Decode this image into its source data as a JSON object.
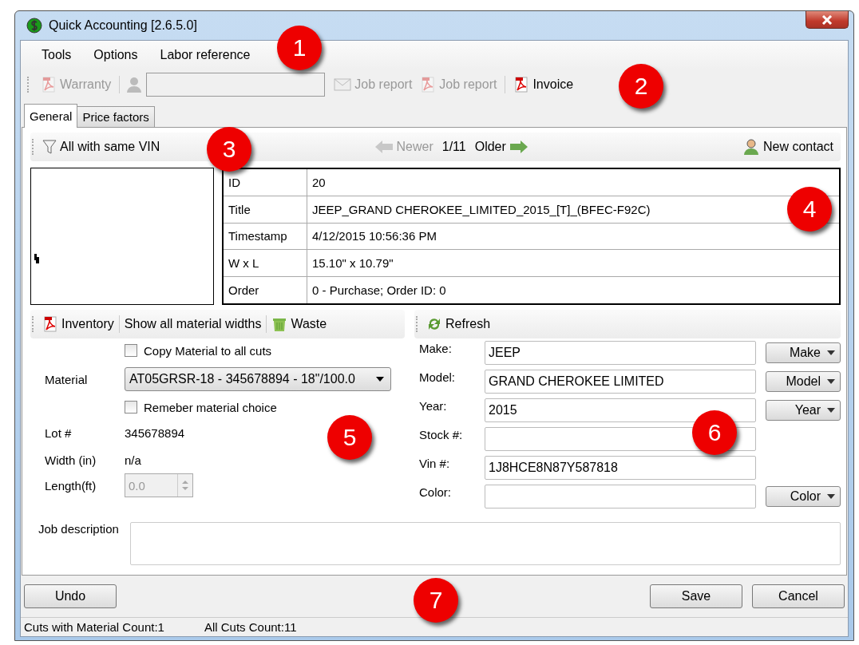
{
  "window": {
    "title": "Quick Accounting [2.6.5.0]"
  },
  "menu": [
    "Tools",
    "Options",
    "Labor reference"
  ],
  "toolbar": [
    {
      "kind": "pdf",
      "label": "Warranty",
      "disabled": true
    },
    {
      "kind": "separator"
    },
    {
      "kind": "contact-field"
    },
    {
      "kind": "mail",
      "label": "Job report",
      "disabled": true
    },
    {
      "kind": "pdf",
      "label": "Job report",
      "disabled": true
    },
    {
      "kind": "separator"
    },
    {
      "kind": "pdf",
      "label": "Invoice",
      "disabled": false
    }
  ],
  "tabs": [
    {
      "label": "General",
      "selected": true
    },
    {
      "label": "Price factors",
      "selected": false
    }
  ],
  "nav_bar": {
    "filter": "All with same VIN",
    "newer": {
      "label": "Newer",
      "disabled": true
    },
    "position": "1/11",
    "older": {
      "label": "Older",
      "disabled": false
    },
    "new_contact": "New contact"
  },
  "details": [
    {
      "label": "ID",
      "value": "20"
    },
    {
      "label": "Title",
      "value": "JEEP_GRAND CHEROKEE_LIMITED_2015_[T]_(BFEC-F92C)"
    },
    {
      "label": "Timestamp",
      "value": "4/12/2015 10:56:36 PM"
    },
    {
      "label": "W x L",
      "value": "15.10\" x 10.79\""
    },
    {
      "label": "Order",
      "value": "0 - Purchase; Order ID: 0"
    }
  ],
  "material_toolbar": [
    {
      "kind": "pdf",
      "label": "Inventory"
    },
    {
      "kind": "separator"
    },
    {
      "kind": "text",
      "label": "Show all material widths"
    },
    {
      "kind": "separator"
    },
    {
      "kind": "trash",
      "label": "Waste"
    }
  ],
  "vehicle_toolbar": {
    "refresh": "Refresh"
  },
  "material_form": {
    "copy_checkbox": {
      "label": "Copy Material to all cuts",
      "checked": false
    },
    "material": {
      "label": "Material",
      "value": "AT05GRSR-18 - 345678894 - 18\"/100.0"
    },
    "remember_checkbox": {
      "label": "Remeber material choice",
      "checked": false
    },
    "lot": {
      "label": "Lot #",
      "value": "345678894"
    },
    "width": {
      "label": "Width (in)",
      "value": "n/a"
    },
    "length": {
      "label": "Length(ft)",
      "value": "0.0",
      "disabled": true
    }
  },
  "vehicle_fields": [
    {
      "label": "Make:",
      "value": "JEEP",
      "button": "Make"
    },
    {
      "label": "Model:",
      "value": "GRAND CHEROKEE LIMITED",
      "button": "Model"
    },
    {
      "label": "Year:",
      "value": "2015",
      "button": "Year"
    },
    {
      "label": "Stock #:"
    },
    {
      "label": "Vin #:",
      "value": "1J8HCE8N87Y587818"
    },
    {
      "label": "Color:",
      "button": "Color"
    }
  ],
  "job_description": {
    "label": "Job description"
  },
  "buttons": {
    "undo": "Undo",
    "save": "Save",
    "cancel": "Cancel"
  },
  "status_bar": [
    "Cuts with Material Count:1",
    "All Cuts Count:11"
  ],
  "callouts": [
    "1",
    "2",
    "3",
    "4",
    "5",
    "6",
    "7"
  ]
}
